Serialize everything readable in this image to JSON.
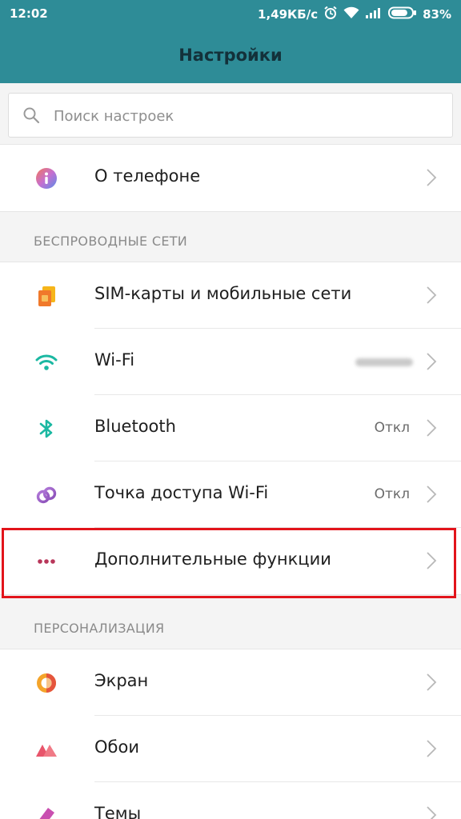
{
  "status_bar": {
    "time": "12:02",
    "network_speed": "1,49КБ/с",
    "battery_percent": "83%",
    "battery_level": 0.83
  },
  "header": {
    "title": "Настройки"
  },
  "search": {
    "placeholder": "Поиск настроек"
  },
  "sections": {
    "about": {
      "items": [
        {
          "label": "О телефоне",
          "icon": "info-icon"
        }
      ]
    },
    "wireless": {
      "header": "БЕСПРОВОДНЫЕ СЕТИ",
      "items": [
        {
          "label": "SIM-карты и мобильные сети",
          "icon": "sim-icon"
        },
        {
          "label": "Wi-Fi",
          "icon": "wifi-icon"
        },
        {
          "label": "Bluetooth",
          "value": "Откл",
          "icon": "bluetooth-icon"
        },
        {
          "label": "Точка доступа Wi-Fi",
          "value": "Откл",
          "icon": "hotspot-icon"
        },
        {
          "label": "Дополнительные функции",
          "icon": "more-icon"
        }
      ]
    },
    "personalization": {
      "header": "ПЕРСОНАЛИЗАЦИЯ",
      "items": [
        {
          "label": "Экран",
          "icon": "display-icon"
        },
        {
          "label": "Обои",
          "icon": "wallpaper-icon"
        },
        {
          "label": "Темы",
          "icon": "themes-icon"
        }
      ]
    }
  },
  "colors": {
    "accent": "#2e8c97",
    "highlight": "#e2141b"
  }
}
